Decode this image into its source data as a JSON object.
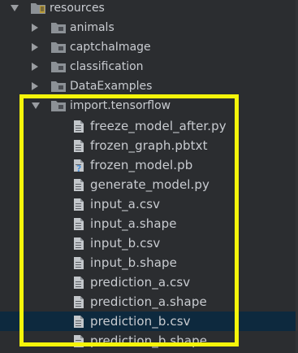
{
  "tree": {
    "root": {
      "label": "resources",
      "icon": "resources-folder-icon"
    },
    "folders": [
      {
        "label": "animals",
        "icon": "folder-icon"
      },
      {
        "label": "captchaImage",
        "icon": "folder-icon"
      },
      {
        "label": "classification",
        "icon": "folder-icon"
      },
      {
        "label": "DataExamples",
        "icon": "folder-icon"
      }
    ],
    "open_folder": {
      "label": "import.tensorflow",
      "icon": "folder-icon"
    },
    "files": [
      {
        "label": "freeze_model_after.py",
        "icon": "file-icon"
      },
      {
        "label": "frozen_graph.pbtxt",
        "icon": "file-icon"
      },
      {
        "label": "frozen_model.pb",
        "icon": "unknown-file-icon"
      },
      {
        "label": "generate_model.py",
        "icon": "file-icon"
      },
      {
        "label": "input_a.csv",
        "icon": "file-icon"
      },
      {
        "label": "input_a.shape",
        "icon": "file-icon"
      },
      {
        "label": "input_b.csv",
        "icon": "file-icon"
      },
      {
        "label": "input_b.shape",
        "icon": "file-icon"
      },
      {
        "label": "prediction_a.csv",
        "icon": "file-icon"
      },
      {
        "label": "prediction_a.shape",
        "icon": "file-icon"
      },
      {
        "label": "prediction_b.csv",
        "icon": "file-icon"
      },
      {
        "label": "prediction_b.shape",
        "icon": "file-icon"
      }
    ],
    "selected_file": "prediction_b.csv"
  },
  "colors": {
    "background": "#2b2d30",
    "text": "#c9ccd1",
    "selection": "#0d293e",
    "highlight_box": "#f5f50a",
    "folder_icon": "#8c9196",
    "file_icon": "#c3c7cb",
    "unknown_badge": "#4d8fd6"
  }
}
